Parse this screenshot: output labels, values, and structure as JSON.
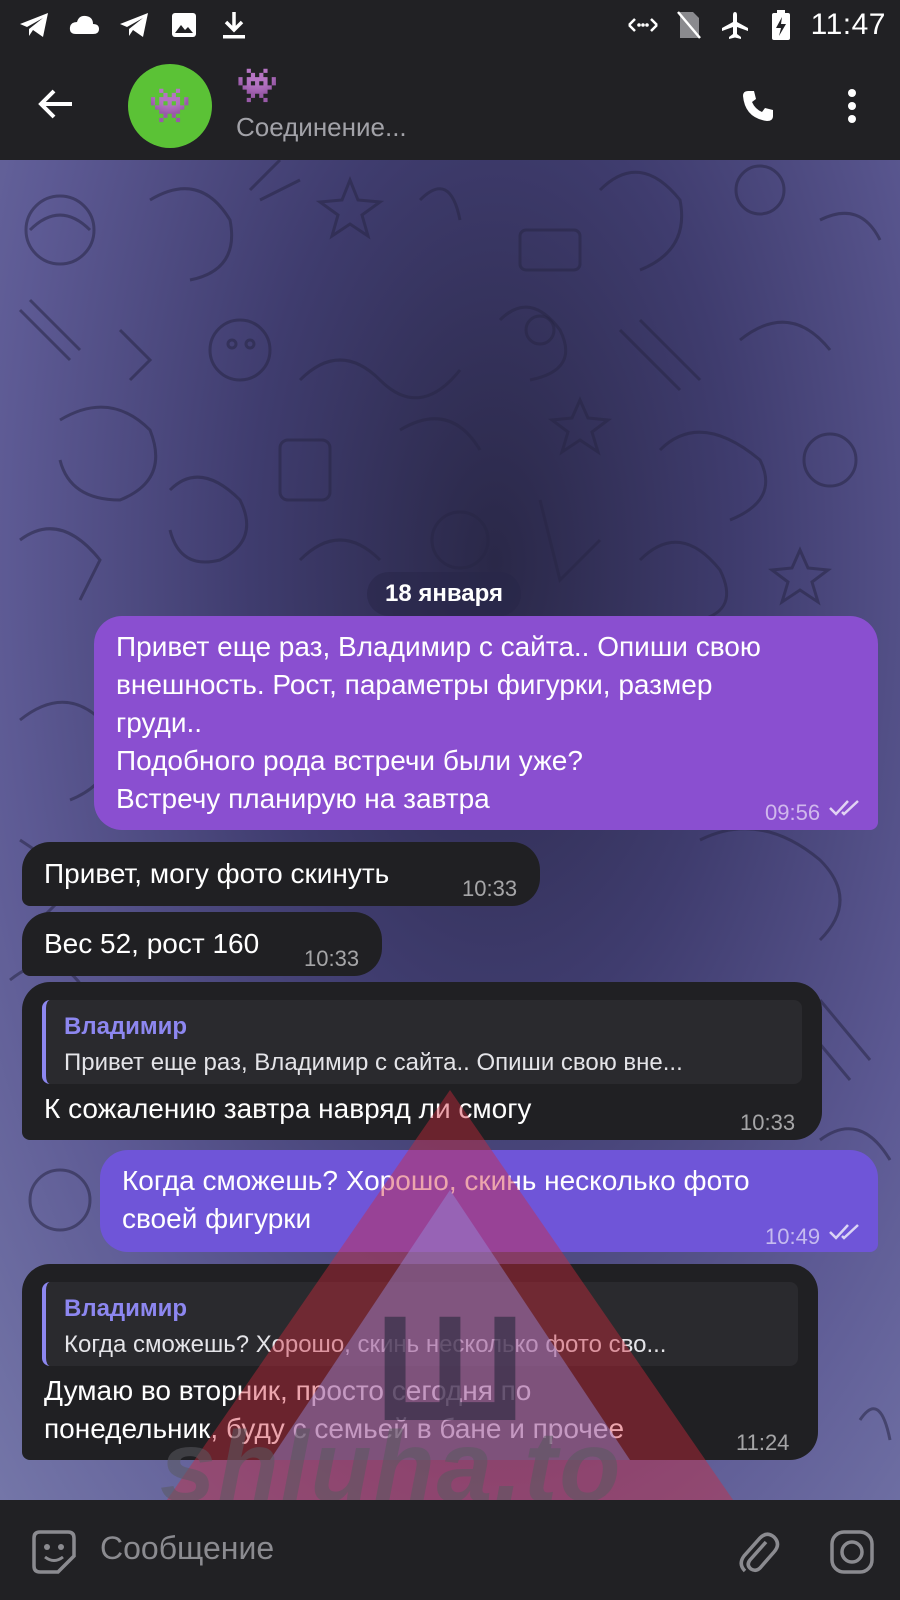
{
  "status_bar": {
    "time": "11:47",
    "left_icons": [
      "telegram-icon",
      "cloud-icon",
      "telegram-icon",
      "image-icon",
      "download-icon"
    ],
    "right_icons": [
      "data-saver-icon",
      "no-sim-icon",
      "airplane-icon",
      "battery-charging-icon"
    ]
  },
  "header": {
    "avatar_emoji": "👾",
    "title": "👾",
    "status": "Соединение..."
  },
  "chat": {
    "date": "18 января",
    "messages": [
      {
        "direction": "out",
        "text_lines": [
          "Привет еще раз, Владимир с сайта.. Опиши свою",
          "внешность. Рост, параметры фигурки, размер",
          "груди..",
          "Подобного рода встречи были уже?",
          "Встречу планирую на завтра"
        ],
        "time": "09:56",
        "read": true
      },
      {
        "direction": "in",
        "text": "Привет, могу фото скинуть",
        "time": "10:33"
      },
      {
        "direction": "in",
        "text": "Вес 52, рост 160",
        "time": "10:33"
      },
      {
        "direction": "in",
        "reply_name": "Владимир",
        "reply_text": "Привет еще раз, Владимир с сайта.. Опиши свою вне...",
        "text": "К сожалению завтра навряд ли смогу",
        "time": "10:33"
      },
      {
        "direction": "out",
        "text_lines": [
          "Когда сможешь? Хорошо, скинь несколько фото",
          "своей фигурки"
        ],
        "time": "10:49",
        "read": true
      },
      {
        "direction": "in",
        "reply_name": "Владимир",
        "reply_text": "Когда сможешь? Хорошо, скинь несколько фото сво...",
        "text_lines": [
          "Думаю во вторник, просто сегодня по",
          "понедельник, буду с семьей в бане и прочее"
        ],
        "time": "11:24"
      }
    ]
  },
  "watermark": {
    "text": "shluha.to",
    "glyph": "Ш"
  },
  "input": {
    "placeholder": "Сообщение"
  },
  "colors": {
    "outgoing": "#8a4fd0",
    "outgoing_alt": "#6f55d8",
    "incoming": "#202023",
    "accent": "#8d87f0",
    "avatar": "#5bc236"
  }
}
